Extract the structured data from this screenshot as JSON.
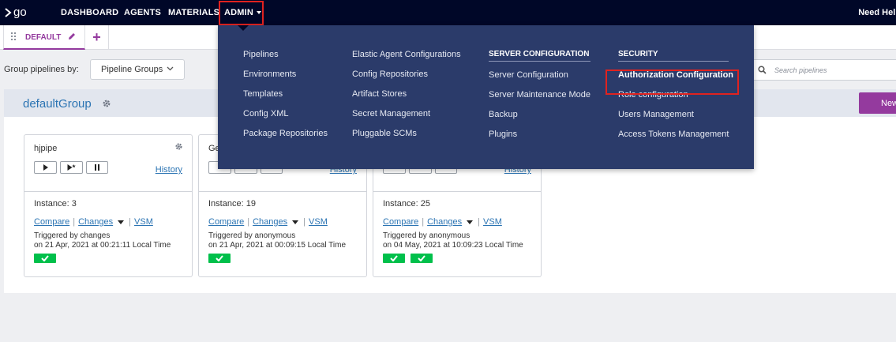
{
  "topnav": {
    "logo_text": "go",
    "items": [
      "DASHBOARD",
      "AGENTS",
      "MATERIALS",
      "ADMIN"
    ],
    "need_help": "Need Help"
  },
  "tabs": {
    "active": "DEFAULT",
    "add": "+"
  },
  "filters": {
    "group_label": "Group pipelines by:",
    "group_value": "Pipeline Groups",
    "search_placeholder": "Search pipelines"
  },
  "group": {
    "name": "defaultGroup",
    "new_button": "New"
  },
  "cards": [
    {
      "title": "hjpipe",
      "history": "History",
      "instance": "Instance: 3",
      "compare": "Compare",
      "changes": "Changes",
      "vsm": "VSM",
      "triggered": "Triggered by changes",
      "time": "on 21 Apr, 2021 at 00:21:11 Local Time",
      "stages": 1
    },
    {
      "title": "Ge",
      "history": "History",
      "instance": "Instance: 19",
      "compare": "Compare",
      "changes": "Changes",
      "vsm": "VSM",
      "triggered": "Triggered by anonymous",
      "time": "on 21 Apr, 2021 at 00:09:15 Local Time",
      "stages": 1
    },
    {
      "title": "",
      "history": "History",
      "instance": "Instance: 25",
      "compare": "Compare",
      "changes": "Changes",
      "vsm": "VSM",
      "triggered": "Triggered by anonymous",
      "time": "on 04 May, 2021 at 10:09:23 Local Time",
      "stages": 2
    }
  ],
  "admin_menu": {
    "col1": [
      "Pipelines",
      "Environments",
      "Templates",
      "Config XML",
      "Package Repositories"
    ],
    "col2": [
      "Elastic Agent Configurations",
      "Config Repositories",
      "Artifact Stores",
      "Secret Management",
      "Pluggable SCMs"
    ],
    "server_heading": "SERVER CONFIGURATION",
    "col3": [
      "Server Configuration",
      "Server Maintenance Mode",
      "Backup",
      "Plugins"
    ],
    "security_heading": "SECURITY",
    "col4": [
      "Authorization Configuration",
      "Role configuration",
      "Users Management",
      "Access Tokens Management"
    ]
  },
  "colors": {
    "nav_bg": "#000728",
    "dropdown_bg": "#2b3b6a",
    "accent_purple": "#943a9e",
    "link_blue": "#2b74b3",
    "stage_green": "#00c04b",
    "highlight_red": "#e0221f"
  }
}
